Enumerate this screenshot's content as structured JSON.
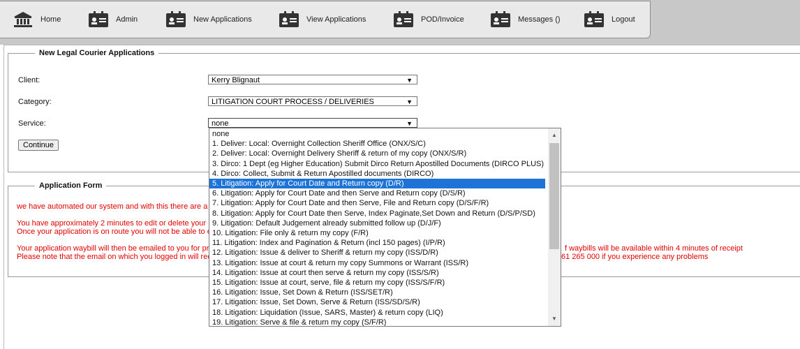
{
  "nav": {
    "home": "Home",
    "admin": "Admin",
    "new_applications": "New Applications",
    "view_applications": "View Applications",
    "pod_invoice": "POD/Invoice",
    "messages": "Messages ()",
    "logout": "Logout"
  },
  "new_app": {
    "legend": "New Legal Courier Applications",
    "client_label": "Client:",
    "client_value": "Kerry Blignaut",
    "category_label": "Category:",
    "category_value": "LITIGATION COURT PROCESS / DELIVERIES",
    "service_label": "Service:",
    "service_value": "none",
    "continue_label": "Continue"
  },
  "app_form": {
    "legend": "Application Form",
    "line1": "we have automated our system and with this there are a",
    "line2": "You have approximately 2 minutes to edit or delete your",
    "line3": "Once your application is on route you will not be able to e",
    "line4": "Your application waybill will then be emailed to you for pr",
    "line4_right": "f waybills will be available within 4 minutes of receipt",
    "line5": "Please note that the email on which you logged in will rec",
    "line5_right": "61 265 000 if you experience any problems"
  },
  "service_options": [
    "none",
    "1. Deliver: Local: Overnight Collection Sheriff Office (ONX/S/C)",
    "2. Deliver: Local: Overnight Delivery Sheriff & return of my copy (ONX/S/R)",
    "3. Dirco: 1 Dept (eg Higher Education) Submit Dirco Return Apostilled Documents (DIRCO PLUS)",
    "4. Dirco: Collect, Submit & Return Apostilled documents (DIRCO)",
    "5. Litigation: Apply for Court Date and Return copy (D/R)",
    "6. Litigation: Apply for Court Date and then Serve and Return copy (D/S/R)",
    "7. Litigation: Apply for Court Date and then Serve, File and Return copy (D/S/F/R)",
    "8. Litigation: Apply for Court Date then Serve, Index Paginate,Set Down and Return (D/S/P/SD)",
    "9. Litigation: Default Judgement already submitted follow up (D/J/F)",
    "10. Litigation: File only & return my copy (F/R)",
    "11. Litigation: Index and Pagination & Return (incl 150 pages) (I/P/R)",
    "12. Litigation: Issue & deliver to Sheriff & return my copy (ISS/D/R)",
    "13. Litigation: Issue at court & return my copy Summons or Warrant (ISS/R)",
    "14. Litigation: Issue at court then serve & return my copy (ISS/S/R)",
    "15. Litigation: Issue at court, serve, file & return my copy (ISS/S/F/R)",
    "16. Litigation: Issue, Set Down & Return (ISS/SET/R)",
    "17. Litigation: Issue, Set Down, Serve & Return (ISS/SD/S/R)",
    "18. Litigation: Liquidation (Issue, SARS, Master) & return copy (LIQ)",
    "19. Litigation: Serve & file & return my copy (S/F/R)"
  ],
  "selected_index": 5,
  "colors": {
    "selection": "#1e74d6",
    "warning_text": "#e00000"
  }
}
